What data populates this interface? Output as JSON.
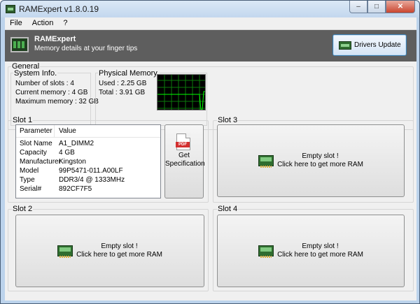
{
  "window": {
    "title": "RAMExpert v1.8.0.19",
    "minimize": "–",
    "maximize": "□",
    "close": "✕"
  },
  "menu": [
    "File",
    "Action",
    "?"
  ],
  "header": {
    "app_name": "RAMExpert",
    "tagline": "Memory details at your finger tips",
    "drivers_update": "Drivers Update"
  },
  "general": {
    "label": "General",
    "system_info": {
      "title": "System Info.",
      "lines": [
        "Number of slots : 4",
        "Current memory : 4 GB",
        "Maximum memory : 32 GB"
      ]
    },
    "physical_memory": {
      "title": "Physical Memory.",
      "used": "Used : 2.25 GB",
      "total": "Total : 3.91 GB"
    }
  },
  "slot1": {
    "label": "Slot 1",
    "columns": [
      "Parameter",
      "Value"
    ],
    "rows": [
      {
        "k": "Slot Name",
        "v": "A1_DIMM2"
      },
      {
        "k": "Capacity",
        "v": "4 GB"
      },
      {
        "k": "Manufacturer",
        "v": "Kingston"
      },
      {
        "k": "Model",
        "v": "99P5471-011.A00LF"
      },
      {
        "k": "Type",
        "v": "DDR3/4 @ 1333MHz"
      },
      {
        "k": "Serial#",
        "v": "892CF7F5"
      }
    ],
    "spec_label": "Get Specification",
    "pdf_text": "PDF"
  },
  "slot2": {
    "label": "Slot 2",
    "line1": "Empty slot !",
    "line2": "Click here to get more RAM"
  },
  "slot3": {
    "label": "Slot 3",
    "line1": "Empty slot !",
    "line2": "Click here to get more RAM"
  },
  "slot4": {
    "label": "Slot 4",
    "line1": "Empty slot !",
    "line2": "Click here to get more RAM"
  },
  "colors": {
    "graph_bg": "#000000",
    "graph_grid": "#0b7a0b",
    "graph_line": "#00ff00",
    "header_bg": "#5e5e5e"
  }
}
